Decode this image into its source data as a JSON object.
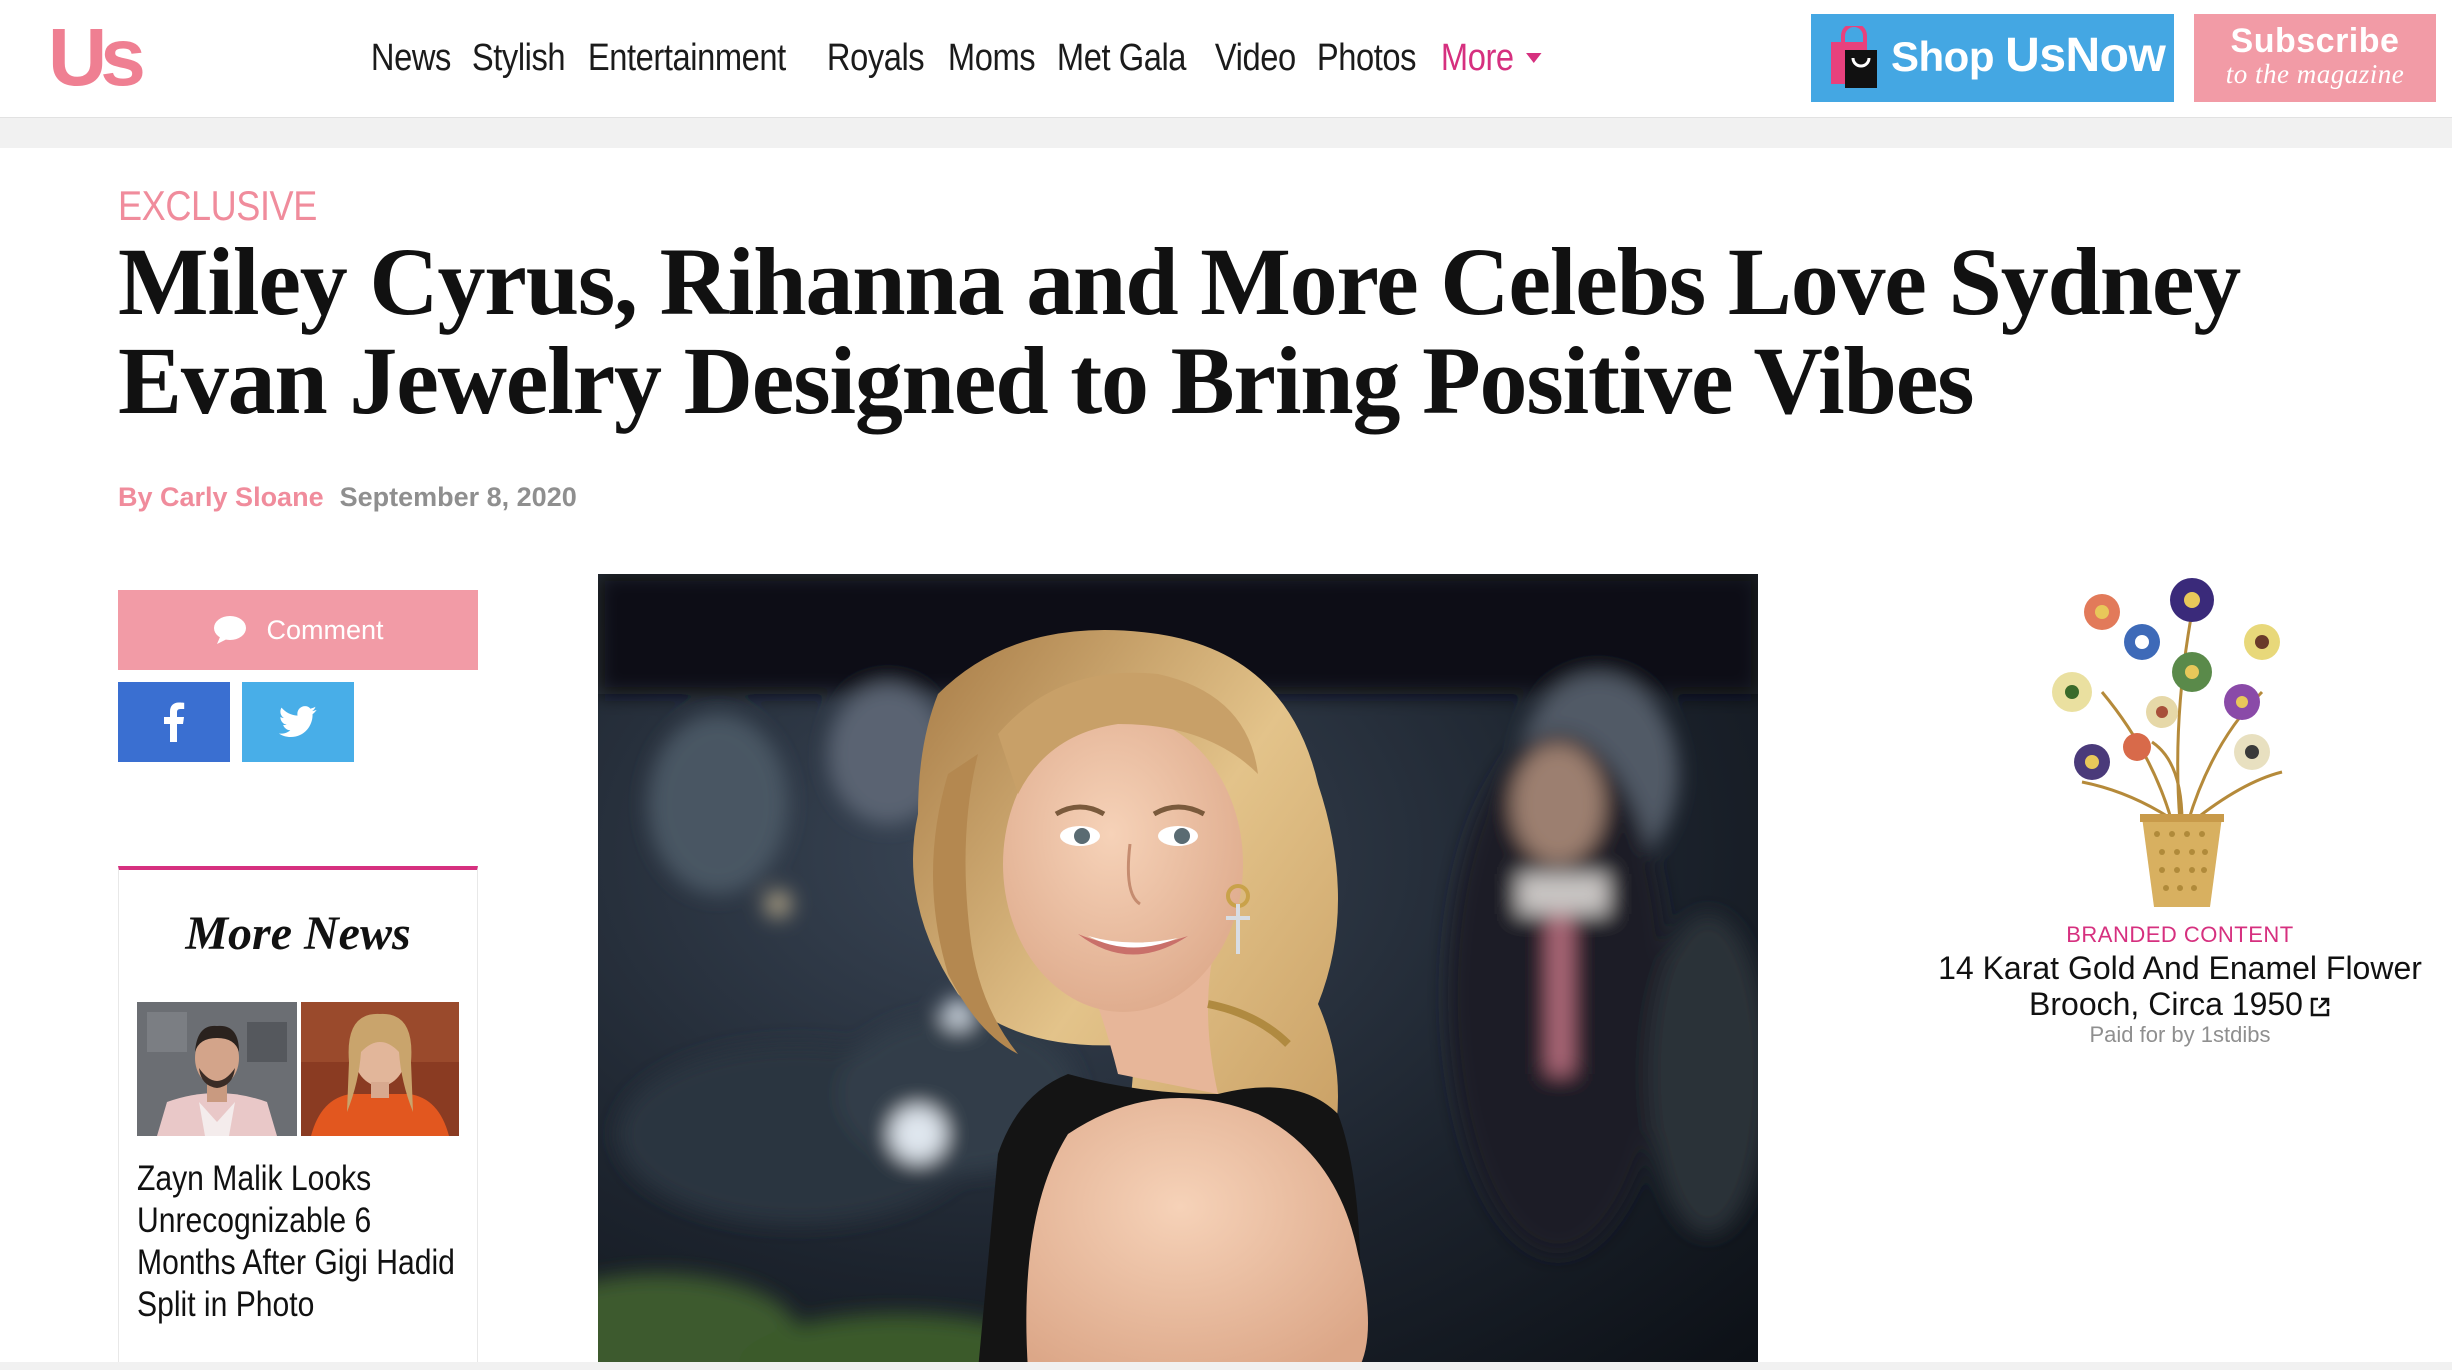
{
  "header": {
    "logo": "Us",
    "nav": [
      "News",
      "Stylish",
      "Entertainment",
      "Royals",
      "Moms",
      "Met Gala",
      "Video",
      "Photos"
    ],
    "more_label": "More",
    "shop_label_prefix": "Shop ",
    "shop_label_brand": "UsNow",
    "subscribe_top": "Subscribe",
    "subscribe_bottom": "to the magazine"
  },
  "article": {
    "kicker": "EXCLUSIVE",
    "headline": "Miley Cyrus, Rihanna and More Celebs Love Sydney Evan Jewelry Designed to Bring Positive Vibes",
    "author": "By Carly Sloane",
    "date": "September 8, 2020"
  },
  "share": {
    "comment_label": "Comment"
  },
  "more_news": {
    "title": "More News",
    "items": [
      {
        "title": "Zayn Malik Looks Unrecognizable 6 Months After Gigi Hadid Split in Photo"
      }
    ]
  },
  "ad": {
    "label": "BRANDED CONTENT",
    "title": "14 Karat Gold And Enamel Flower Brooch, Circa 1950",
    "paid_by": "Paid for by 1stdibs"
  },
  "colors": {
    "brand_pink": "#ef7f92",
    "accent_magenta": "#d6307f",
    "shop_blue": "#44a7e3",
    "facebook_blue": "#3a6fd1",
    "twitter_blue": "#48aee8"
  }
}
